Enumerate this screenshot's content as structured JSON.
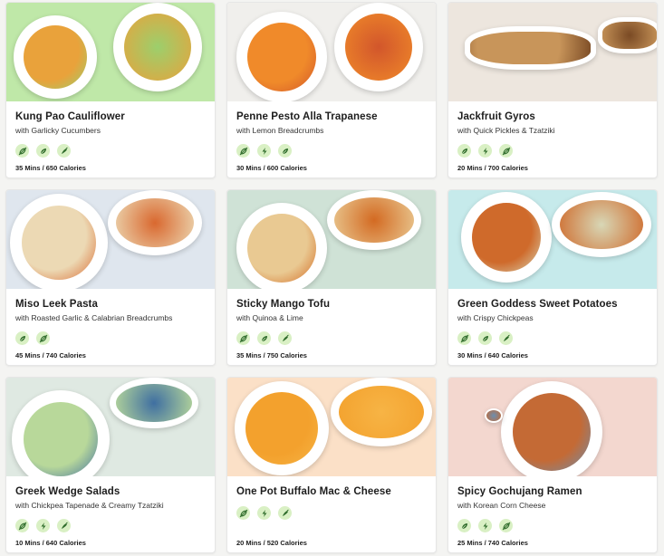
{
  "colors": {
    "card_bg": "#ffffff",
    "tag_bg": "#d9f0c4",
    "tag_icon": "#2e6b2a"
  },
  "meals": [
    {
      "title": "Kung Pao Cauliflower",
      "subtitle": "with Garlicky Cucumbers",
      "meta": "35 Mins / 650 Calories",
      "bg": "#bfe8a8",
      "food": "#e9a23b",
      "side": "#9ccf6c",
      "tags": [
        "vegan-icon",
        "leaf-icon",
        "chili-icon"
      ]
    },
    {
      "title": "Penne Pesto Alla Trapanese",
      "subtitle": "with Lemon Breadcrumbs",
      "meta": "30 Mins / 600 Calories",
      "bg": "#f0efec",
      "food": "#f08a2a",
      "side": "#d2562b",
      "tags": [
        "vegan-icon",
        "bolt-icon",
        "leaf-icon"
      ]
    },
    {
      "title": "Jackfruit Gyros",
      "subtitle": "with Quick Pickles & Tzatziki",
      "meta": "20 Mins / 700 Calories",
      "bg": "#ede6de",
      "food": "#c8955a",
      "side": "#7a4a24",
      "tags": [
        "leaf-icon",
        "bolt-icon",
        "vegan-icon"
      ]
    },
    {
      "title": "Miso Leek Pasta",
      "subtitle": "with Roasted Garlic & Calabrian Breadcrumbs",
      "meta": "45 Mins / 740 Calories",
      "bg": "#dfe6ee",
      "food": "#ecd9b4",
      "side": "#d9682f",
      "tags": [
        "leaf-icon",
        "vegan-icon"
      ]
    },
    {
      "title": "Sticky Mango Tofu",
      "subtitle": "with Quinoa & Lime",
      "meta": "35 Mins / 750 Calories",
      "bg": "#cfe2d6",
      "food": "#e9c992",
      "side": "#d36a22",
      "tags": [
        "vegan-icon",
        "leaf-icon",
        "chili-icon"
      ]
    },
    {
      "title": "Green Goddess Sweet Potatoes",
      "subtitle": "with Crispy Chickpeas",
      "meta": "30 Mins / 640 Calories",
      "bg": "#c6eaeb",
      "food": "#cf6a2b",
      "side": "#d8d7b6",
      "tags": [
        "vegan-icon",
        "leaf-icon",
        "chili-icon"
      ]
    },
    {
      "title": "Greek Wedge Salads",
      "subtitle": "with Chickpea Tapenade & Creamy Tzatziki",
      "meta": "10 Mins / 640 Calories",
      "bg": "#dfe9e2",
      "food": "#b8d89a",
      "side": "#3f6fa1",
      "tags": [
        "vegan-icon",
        "bolt-icon",
        "chili-icon"
      ]
    },
    {
      "title": "One Pot Buffalo Mac & Cheese",
      "subtitle": "",
      "meta": "20 Mins / 520 Calories",
      "bg": "#fbe0c7",
      "food": "#f3a12d",
      "side": "#f7b445",
      "tags": [
        "vegan-icon",
        "bolt-icon",
        "chili-icon"
      ]
    },
    {
      "title": "Spicy Gochujang Ramen",
      "subtitle": "with Korean Corn Cheese",
      "meta": "25 Mins / 740 Calories",
      "bg": "#f3d7cf",
      "food": "#c46a35",
      "side": "#6c8fb0",
      "tags": [
        "leaf-icon",
        "bolt-icon",
        "vegan-icon"
      ]
    }
  ]
}
